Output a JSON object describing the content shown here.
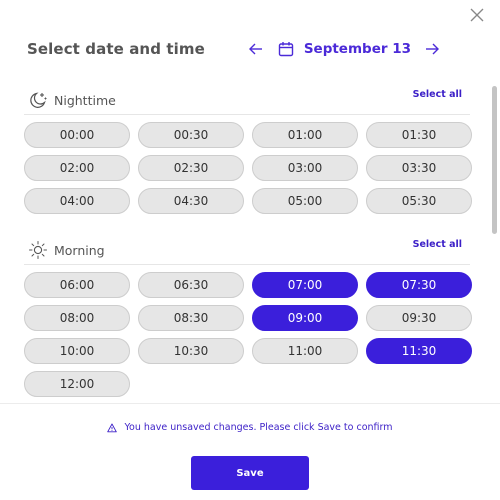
{
  "header": {
    "title": "Select date and time",
    "date": "September 13"
  },
  "sections": [
    {
      "title": "Nighttime",
      "select_all": "Select all",
      "icon": "moon-stars-icon",
      "slots": [
        {
          "time": "00:00",
          "selected": false
        },
        {
          "time": "00:30",
          "selected": false
        },
        {
          "time": "01:00",
          "selected": false
        },
        {
          "time": "01:30",
          "selected": false
        },
        {
          "time": "02:00",
          "selected": false
        },
        {
          "time": "02:30",
          "selected": false
        },
        {
          "time": "03:00",
          "selected": false
        },
        {
          "time": "03:30",
          "selected": false
        },
        {
          "time": "04:00",
          "selected": false
        },
        {
          "time": "04:30",
          "selected": false
        },
        {
          "time": "05:00",
          "selected": false
        },
        {
          "time": "05:30",
          "selected": false
        }
      ]
    },
    {
      "title": "Morning",
      "select_all": "Select all",
      "icon": "sun-icon",
      "slots": [
        {
          "time": "06:00",
          "selected": false
        },
        {
          "time": "06:30",
          "selected": false
        },
        {
          "time": "07:00",
          "selected": true
        },
        {
          "time": "07:30",
          "selected": true
        },
        {
          "time": "08:00",
          "selected": false
        },
        {
          "time": "08:30",
          "selected": false
        },
        {
          "time": "09:00",
          "selected": true
        },
        {
          "time": "09:30",
          "selected": false
        },
        {
          "time": "10:00",
          "selected": false
        },
        {
          "time": "10:30",
          "selected": false
        },
        {
          "time": "11:00",
          "selected": false
        },
        {
          "time": "11:30",
          "selected": true
        },
        {
          "time": "12:00",
          "selected": false
        }
      ]
    }
  ],
  "notice": "You have unsaved changes. Please click Save to confirm",
  "save_label": "Save",
  "colors": {
    "accent": "#3b1fdb",
    "slot_bg": "#e6e6e6",
    "text": "#555555"
  }
}
